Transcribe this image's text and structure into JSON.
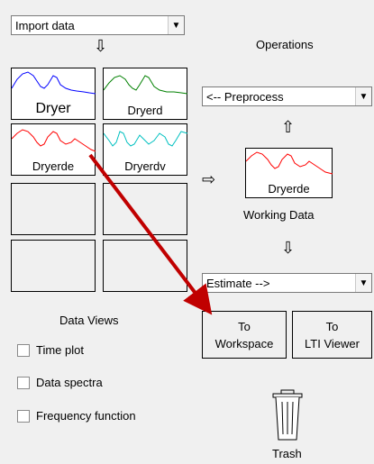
{
  "import": {
    "value": "Import data"
  },
  "operations_title": "Operations",
  "preprocess": {
    "value": "<-- Preprocess"
  },
  "estimate": {
    "value": "Estimate -->"
  },
  "data_views_title": "Data Views",
  "tiles": [
    {
      "label": "Dryer",
      "color": "#0000ff"
    },
    {
      "label": "Dryerd",
      "color": "#008000"
    },
    {
      "label": "Dryerde",
      "color": "#ff0000"
    },
    {
      "label": "Dryerdv",
      "color": "#00c0c0"
    }
  ],
  "working_data": {
    "label": "Dryerde",
    "caption": "Working Data",
    "color": "#ff0000"
  },
  "to_workspace": {
    "line1": "To",
    "line2": "Workspace"
  },
  "to_lti": {
    "line1": "To",
    "line2": "LTI Viewer"
  },
  "checks": [
    "Time plot",
    "Data spectra",
    "Frequency function"
  ],
  "trash_label": "Trash",
  "colors": {
    "drag_arrow": "#c00000"
  }
}
